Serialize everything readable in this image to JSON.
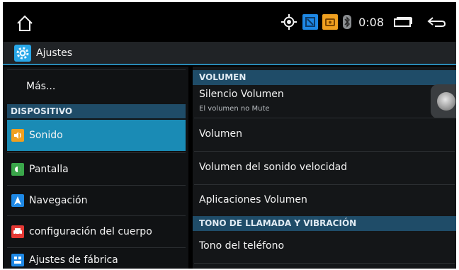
{
  "status_bar": {
    "home_icon": "home-outline-icon",
    "time": "0:08",
    "icons": [
      "gps-icon",
      "blue-app-icon",
      "orange-app-icon",
      "bluetooth-icon",
      "recent-apps-icon",
      "back-arrow-icon"
    ]
  },
  "action_bar": {
    "app_icon": "settings-gear-icon",
    "title": "Ajustes"
  },
  "left_menu": {
    "more_label": "Más...",
    "section_header": "DISPOSITIVO",
    "items": [
      {
        "label": "Sonido",
        "icon": "sound-icon",
        "color": "#f0a020",
        "selected": true
      },
      {
        "label": "Pantalla",
        "icon": "display-icon",
        "color": "#3aa64a",
        "selected": false
      },
      {
        "label": "Navegación",
        "icon": "navigation-icon",
        "color": "#1e88e5",
        "selected": false
      },
      {
        "label": "configuración del cuerpo",
        "icon": "car-body-icon",
        "color": "#e53935",
        "selected": false
      },
      {
        "label": "Ajustes de fábrica",
        "icon": "factory-settings-icon",
        "color": "#1e88e5",
        "selected": false
      }
    ]
  },
  "right_panel": {
    "header_volume": "VOLUMEN",
    "mute": {
      "title": "Silencio Volumen",
      "subtitle": "El volumen no Mute",
      "enabled": false
    },
    "items": [
      "Volumen",
      "Volumen del sonido velocidad",
      "Aplicaciones Volumen"
    ],
    "header_ringtone": "TONO DE LLAMADA Y VIBRACIÓN",
    "ringtone_item": "Tono del teléfono"
  },
  "colors": {
    "accent": "#1a8bb5",
    "header": "#1f4c68",
    "background": "#000000"
  }
}
